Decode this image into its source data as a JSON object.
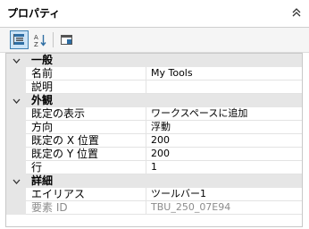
{
  "panel": {
    "title": "プロパティ"
  },
  "toolbar": {
    "buttons": [
      {
        "name": "categorized-view-icon"
      },
      {
        "name": "alphabetical-sort-icon"
      },
      {
        "name": "property-pages-icon"
      }
    ]
  },
  "grid": {
    "categories": [
      {
        "label": "一般",
        "properties": [
          {
            "name": "名前",
            "value": "My Tools"
          },
          {
            "name": "説明",
            "value": ""
          }
        ]
      },
      {
        "label": "外観",
        "properties": [
          {
            "name": "既定の表示",
            "value": "ワークスペースに追加"
          },
          {
            "name": "方向",
            "value": "浮動"
          },
          {
            "name": "既定の X 位置",
            "value": "200"
          },
          {
            "name": "既定の Y 位置",
            "value": "200"
          },
          {
            "name": "行",
            "value": "1"
          }
        ]
      },
      {
        "label": "詳細",
        "properties": [
          {
            "name": "エイリアス",
            "value": "ツールバー1"
          },
          {
            "name": "要素 ID",
            "value": "TBU_250_07E94",
            "readonly": true
          }
        ]
      }
    ]
  },
  "colors": {
    "accent": "#3c7fb1",
    "category_bg": "#e6e6e6",
    "readonly_text": "#8c8c8c"
  }
}
